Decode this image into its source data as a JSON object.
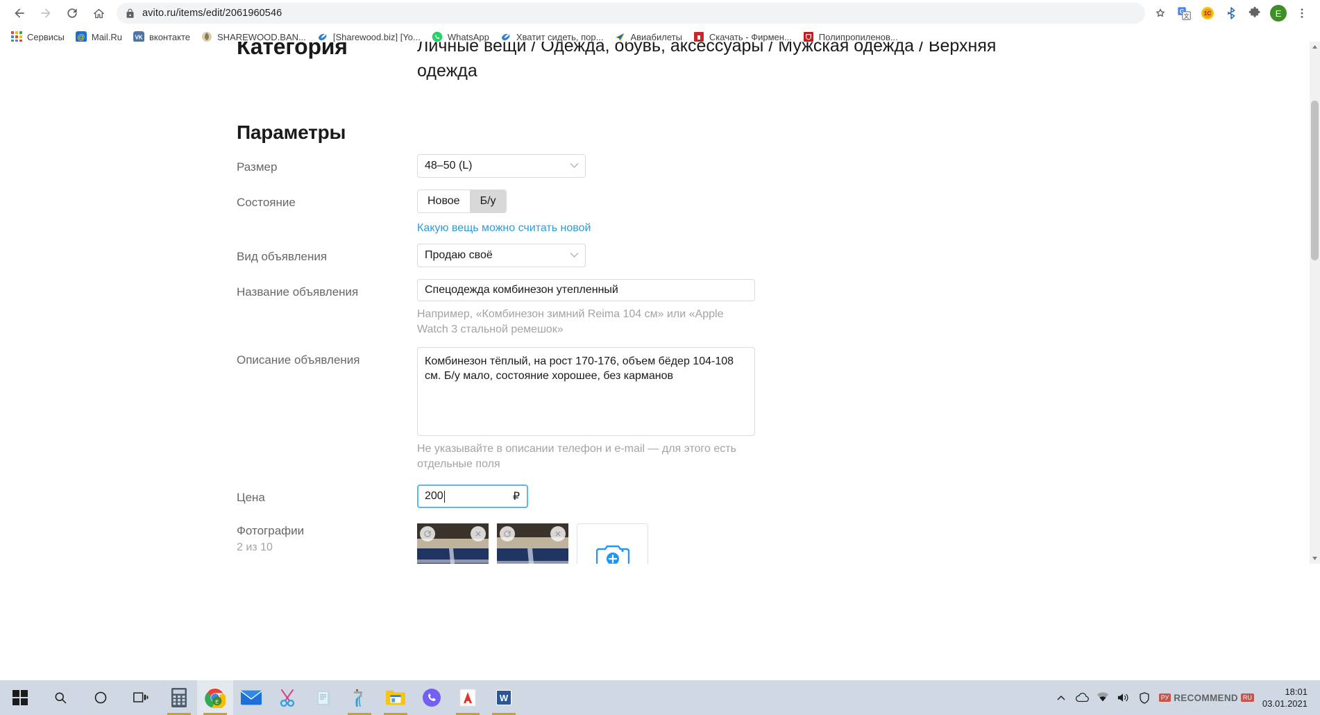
{
  "browser": {
    "url": "avito.ru/items/edit/2061960546",
    "nav": {
      "back": "back-arrow",
      "forward": "forward-arrow",
      "reload": "reload",
      "home": "home"
    },
    "toolbar_icons": [
      "star-icon",
      "google-translate-icon",
      "extension-1c-icon",
      "bluetooth-icon",
      "puzzle-extensions-icon",
      "profile-avatar-icon",
      "chrome-menu-icon"
    ],
    "profile_letter": "E",
    "bookmarks": [
      {
        "label": "Сервисы",
        "icon": "apps-grid-icon"
      },
      {
        "label": "Mail.Ru",
        "icon": "mailru-icon"
      },
      {
        "label": "вконтакте",
        "icon": "vk-icon"
      },
      {
        "label": "SHAREWOOD.BAN...",
        "icon": "sharewood-icon"
      },
      {
        "label": "[Sharewood.biz] [Yo...",
        "icon": "blue-swirl-icon"
      },
      {
        "label": "WhatsApp",
        "icon": "whatsapp-icon"
      },
      {
        "label": "Хватит сидеть, пор...",
        "icon": "blue-swirl-icon"
      },
      {
        "label": "Авиабилеты",
        "icon": "plane-icon"
      },
      {
        "label": "Скачать - Фирмен...",
        "icon": "red-doc-icon"
      },
      {
        "label": "Полипропиленов...",
        "icon": "red-shield-icon"
      }
    ]
  },
  "page": {
    "category": {
      "label": "Категория",
      "value": "Личные вещи / Одежда, обувь, аксессуары / Мужская одежда / Верхняя одежда"
    },
    "parameters_title": "Параметры",
    "size": {
      "label": "Размер",
      "value": "48–50 (L)"
    },
    "condition": {
      "label": "Состояние",
      "options": [
        "Новое",
        "Б/у"
      ],
      "selected": "Б/у",
      "help_link": "Какую вещь можно считать новой"
    },
    "ad_type": {
      "label": "Вид объявления",
      "value": "Продаю своё"
    },
    "title_field": {
      "label": "Название объявления",
      "value": "Спецодежда комбинезон утепленный",
      "hint": "Например, «Комбинезон зимний Reima 104 см» или «Apple Watch 3 стальной ремешок»"
    },
    "description_field": {
      "label": "Описание объявления",
      "value": "Комбинезон тёплый, на рост 170-176, объем бёдер 104-108 см. Б/у мало, состояние хорошее, без карманов",
      "hint": "Не указывайте в описании телефон и e-mail — для этого есть отдельные поля"
    },
    "price_field": {
      "label": "Цена",
      "value": "200",
      "currency": "₽"
    },
    "photos": {
      "label": "Фотографии",
      "count_text": "2 из 10",
      "add_icon": "camera-add-icon",
      "rotate_icon": "rotate-icon",
      "delete_icon": "close-icon"
    },
    "colors": {
      "link": "#2f9bd6",
      "focus_border": "#5cb8ea",
      "hint_text": "#a3a3a3",
      "label_text": "#66676b"
    }
  },
  "taskbar": {
    "start": "windows-start-icon",
    "search": "search-icon",
    "cortana": "cortana-circle-icon",
    "taskview": "task-view-icon",
    "apps": [
      {
        "name": "calculator-icon"
      },
      {
        "name": "chrome-icon"
      },
      {
        "name": "mail-icon"
      },
      {
        "name": "snipping-tool-icon"
      },
      {
        "name": "notepad-icon"
      },
      {
        "name": "faucet-icon"
      },
      {
        "name": "file-explorer-icon"
      },
      {
        "name": "viber-icon"
      },
      {
        "name": "avast-icon"
      },
      {
        "name": "word-icon"
      }
    ],
    "tray": [
      "chevron-up-icon",
      "onedrive-icon",
      "network-icon",
      "volume-icon",
      "shield-icon"
    ],
    "clock_time": "18:01",
    "clock_date": "03.01.2021",
    "watermark": "RECOMMEND",
    "watermark_prefix": "РУ",
    "watermark_suffix": "RU"
  }
}
